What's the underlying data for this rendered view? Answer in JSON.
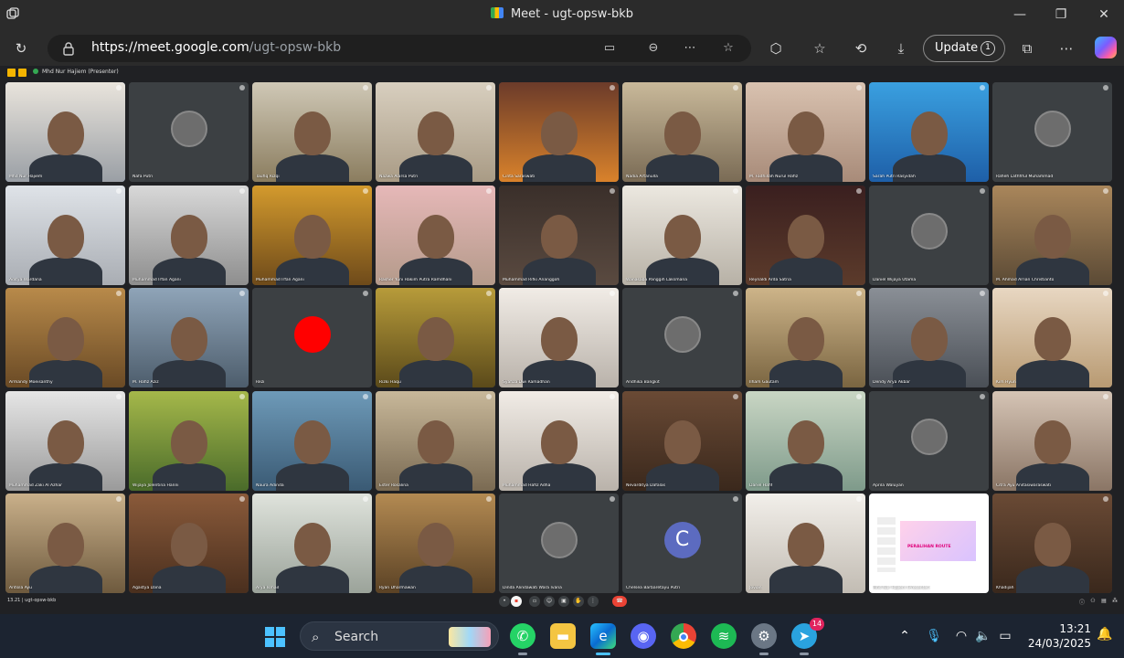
{
  "window": {
    "title": "Meet - ugt-opsw-bkb",
    "controls": {
      "minimize": "—",
      "restore": "❐",
      "close": "✕"
    }
  },
  "toolbar": {
    "url_host": "https://meet.google.com",
    "url_path": "/ugt-opsw-bkb",
    "update_label": "Update",
    "update_badge": "1"
  },
  "meet": {
    "presenter_banner": "Mhd Nur Hajiem (Presenter)",
    "meeting_code": "13.21  |  ugt-opsw-bkb",
    "shared_screen_title": "PERALIHAN ROUTE",
    "participants": [
      {
        "name": "Mhd Nur Hajiem",
        "kind": "video"
      },
      {
        "name": "Nafa Putri",
        "kind": "avatar"
      },
      {
        "name": "Taufiq Rizqi",
        "kind": "video"
      },
      {
        "name": "Nazwa Alarsa Putri",
        "kind": "video"
      },
      {
        "name": "Cinta Saraswati",
        "kind": "video"
      },
      {
        "name": "Nadia Artanulla",
        "kind": "video"
      },
      {
        "name": "M. Fadhillah Nurul Hafiz",
        "kind": "video"
      },
      {
        "name": "Sarah Putri Rasyidah",
        "kind": "video"
      },
      {
        "name": "Rafieh Lathfiful Muhammad",
        "kind": "avatar"
      },
      {
        "name": "Aditya Wardana",
        "kind": "video"
      },
      {
        "name": "Muhammad Irfan Agani",
        "kind": "video"
      },
      {
        "name": "Muhammad Irfan Agani",
        "kind": "video"
      },
      {
        "name": "Rasher Yuni Hakim Putra Ramdhani",
        "kind": "video"
      },
      {
        "name": "Muhammad Rifki Ananggoh",
        "kind": "video"
      },
      {
        "name": "Wanasaba Panggih Laksmana",
        "kind": "video"
      },
      {
        "name": "Reynaldi Arda Satria",
        "kind": "video"
      },
      {
        "name": "Daniel Wijaya Utama",
        "kind": "avatar"
      },
      {
        "name": "M. Ahmad Arnan Christianto",
        "kind": "video"
      },
      {
        "name": "Armandy Moeisanthy",
        "kind": "video"
      },
      {
        "name": "M. Hafiz Aziz",
        "kind": "video"
      },
      {
        "name": "Rezi",
        "kind": "red"
      },
      {
        "name": "Rizki Haqu",
        "kind": "video"
      },
      {
        "name": "Syafiza Dwi Ramadhan",
        "kind": "video"
      },
      {
        "name": "Andhika Bangkit",
        "kind": "avatar"
      },
      {
        "name": "Ilham Gautam",
        "kind": "video"
      },
      {
        "name": "Dendy Arya Akbar",
        "kind": "video"
      },
      {
        "name": "Kim Hyun",
        "kind": "video"
      },
      {
        "name": "Muhammad Zaki Al Azhar",
        "kind": "video"
      },
      {
        "name": "Wijaya Jolentina Hanni",
        "kind": "video"
      },
      {
        "name": "Naura Adinda",
        "kind": "video"
      },
      {
        "name": "Ester Rosalina",
        "kind": "video"
      },
      {
        "name": "Muhammad Hafiz Adha",
        "kind": "video"
      },
      {
        "name": "Nevarditya Dafalas",
        "kind": "video"
      },
      {
        "name": "Dariel Hafif",
        "kind": "video"
      },
      {
        "name": "Aprila Waluyan",
        "kind": "avatar"
      },
      {
        "name": "Citra Ayu Anitasiwaraswati",
        "kind": "video"
      },
      {
        "name": "Antsila Ayu",
        "kind": "video"
      },
      {
        "name": "Agastya Dana",
        "kind": "video"
      },
      {
        "name": "Arya Ismail",
        "kind": "video"
      },
      {
        "name": "Ryan Dharmawan",
        "kind": "video"
      },
      {
        "name": "Dinda Alindawati Wara Ivana",
        "kind": "avatar"
      },
      {
        "name": "Chelsea Barbaretayu Putri",
        "kind": "letter",
        "letter": "C"
      },
      {
        "name": "Jovian",
        "kind": "video"
      },
      {
        "name": "Mhd Nur Hajiem (Presenter)",
        "kind": "screen"
      },
      {
        "name": "Khadijah",
        "kind": "video"
      }
    ]
  },
  "taskbar": {
    "search_label": "Search",
    "telegram_badge": "14",
    "time": "13:21",
    "date": "24/03/2025"
  }
}
